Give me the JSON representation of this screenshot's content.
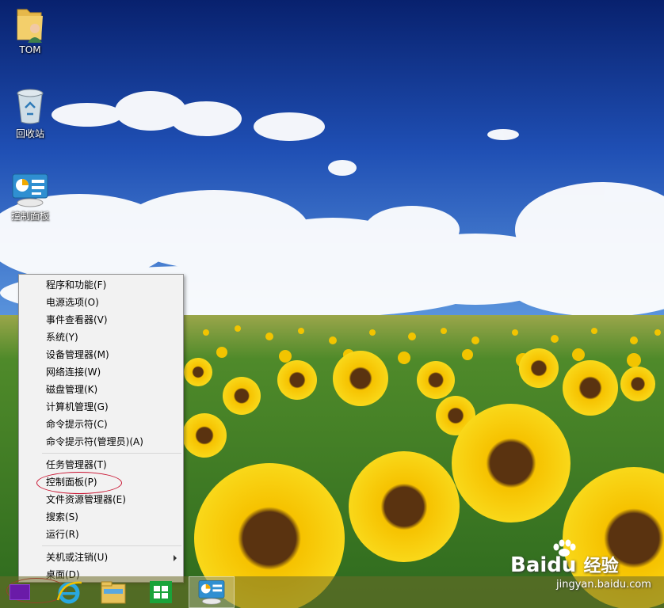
{
  "desktop": {
    "icons": [
      {
        "label": "TOM",
        "icon": "user-folder-icon"
      },
      {
        "label": "回收站",
        "icon": "recycle-bin-icon"
      },
      {
        "label": "控制面板",
        "icon": "control-panel-icon"
      }
    ]
  },
  "context_menu": {
    "groups": [
      [
        "程序和功能(F)",
        "电源选项(O)",
        "事件查看器(V)",
        "系统(Y)",
        "设备管理器(M)",
        "网络连接(W)",
        "磁盘管理(K)",
        "计算机管理(G)",
        "命令提示符(C)",
        "命令提示符(管理员)(A)"
      ],
      [
        "任务管理器(T)",
        "控制面板(P)",
        "文件资源管理器(E)",
        "搜索(S)",
        "运行(R)"
      ],
      [
        "关机或注销(U)",
        "桌面(D)"
      ]
    ],
    "highlighted_item": "控制面板(P)"
  },
  "taskbar": {
    "items": [
      {
        "name": "start-button",
        "icon": "windows-logo-icon"
      },
      {
        "name": "internet-explorer",
        "icon": "internet-explorer-icon"
      },
      {
        "name": "file-explorer",
        "icon": "file-explorer-icon"
      },
      {
        "name": "store",
        "icon": "windows-store-icon"
      },
      {
        "name": "control-panel",
        "icon": "control-panel-icon"
      }
    ]
  },
  "watermark": {
    "brand": "Bai",
    "brand_suffix": "du",
    "cn": "经验",
    "url": "jingyan.baidu.com"
  },
  "colors": {
    "annotation_circle": "#c8102e",
    "start_logo": "#6a1ba8"
  }
}
